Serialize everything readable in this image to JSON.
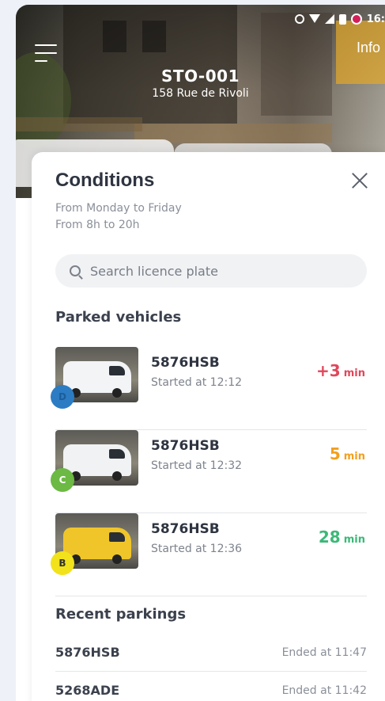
{
  "status_bar": {
    "time": "16:"
  },
  "header": {
    "info_label": "Info",
    "station_code": "STO-001",
    "station_address": "158 Rue de Rivoli"
  },
  "sheet": {
    "title": "Conditions",
    "conditions": [
      "From Monday to Friday",
      "From 8h to 20h"
    ],
    "search": {
      "placeholder": "Search licence plate",
      "value": ""
    },
    "parked_title": "Parked vehicles",
    "parked": [
      {
        "plate": "5876HSB",
        "started": "Started at 12:12",
        "duration_value": "+3",
        "duration_unit": "min",
        "duration_color": "#e0475b",
        "badge": "D",
        "badge_color": "#2c7cc4",
        "badge_text_color": "#1d5d99",
        "van_color": "#f3f4f6"
      },
      {
        "plate": "5876HSB",
        "started": "Started at 12:32",
        "duration_value": "5",
        "duration_unit": "min",
        "duration_color": "#f2a01e",
        "badge": "C",
        "badge_color": "#6cb944",
        "badge_text_color": "#ffffff",
        "van_color": "#f1f2f3"
      },
      {
        "plate": "5876HSB",
        "started": "Started at 12:36",
        "duration_value": "28",
        "duration_unit": "min",
        "duration_color": "#3cb878",
        "badge": "B",
        "badge_color": "#f2e21b",
        "badge_text_color": "#333333",
        "van_color": "#f0c52a"
      }
    ],
    "recent_title": "Recent parkings",
    "recent": [
      {
        "plate": "5876HSB",
        "ended": "Ended at 11:47"
      },
      {
        "plate": "5268ADE",
        "ended": "Ended at 11:42"
      }
    ]
  }
}
